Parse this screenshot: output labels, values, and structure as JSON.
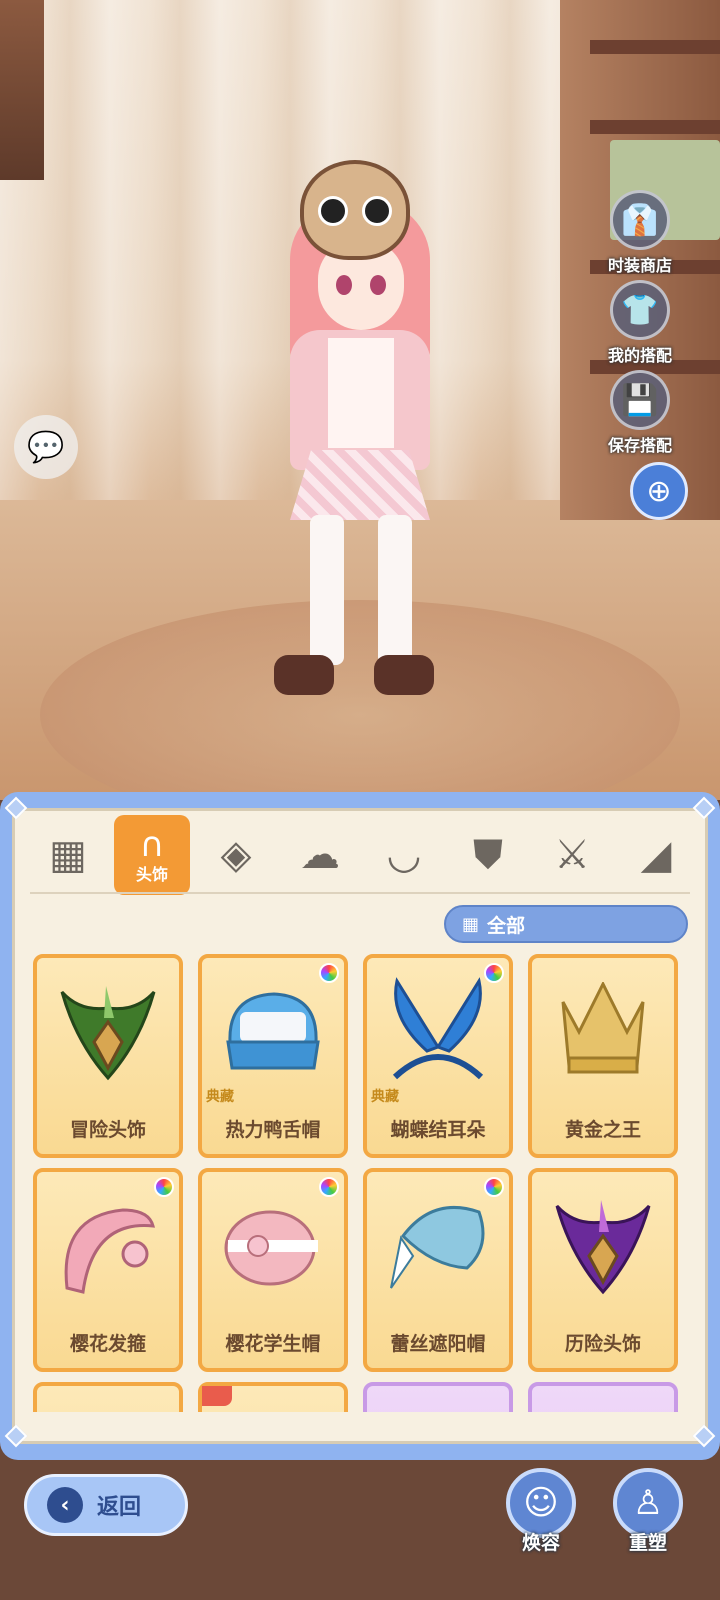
{
  "side_buttons": [
    {
      "label": "时装商店",
      "icon": "shirt-icon"
    },
    {
      "label": "我的搭配",
      "icon": "hanger-icon"
    },
    {
      "label": "保存搭配",
      "icon": "save-icon"
    }
  ],
  "tabs": [
    {
      "icon": "grid-icon",
      "label": ""
    },
    {
      "icon": "cat-ear-headband-icon",
      "label": "头饰"
    },
    {
      "icon": "mask-icon",
      "label": ""
    },
    {
      "icon": "hair-icon",
      "label": ""
    },
    {
      "icon": "eyes-icon",
      "label": ""
    },
    {
      "icon": "jacket-icon",
      "label": ""
    },
    {
      "icon": "sword-icon",
      "label": ""
    },
    {
      "icon": "cape-icon",
      "label": ""
    }
  ],
  "filter": {
    "label": "全部",
    "icon": "grid-icon"
  },
  "items": [
    {
      "name": "冒险头饰",
      "tag": "",
      "dyeable": false
    },
    {
      "name": "热力鸭舌帽",
      "tag": "典藏",
      "dyeable": true
    },
    {
      "name": "蝴蝶结耳朵",
      "tag": "典藏",
      "dyeable": true
    },
    {
      "name": "黄金之王",
      "tag": "",
      "dyeable": false
    },
    {
      "name": "樱花发箍",
      "tag": "",
      "dyeable": true
    },
    {
      "name": "樱花学生帽",
      "tag": "",
      "dyeable": true
    },
    {
      "name": "蕾丝遮阳帽",
      "tag": "",
      "dyeable": true
    },
    {
      "name": "历险头饰",
      "tag": "",
      "dyeable": false
    }
  ],
  "bottom": {
    "back_label": "返回",
    "makeup_label": "焕容",
    "reshape_label": "重塑"
  },
  "colors": {
    "accent_orange": "#f39a35",
    "panel_blue": "#8fb3f0",
    "card_border": "#f3a843"
  }
}
